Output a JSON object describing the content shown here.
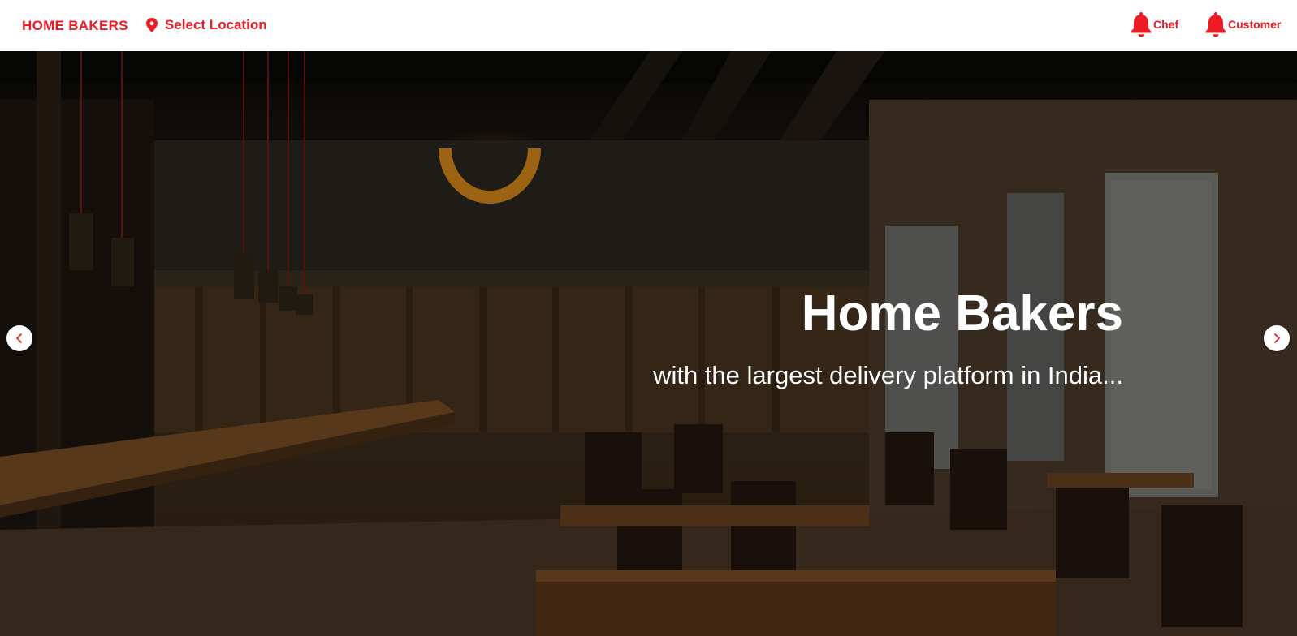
{
  "navbar": {
    "brand": "HOME BAKERS",
    "location_label": "Select Location",
    "links": [
      {
        "label": "Chef",
        "icon": "bell-icon"
      },
      {
        "label": "Customer",
        "icon": "bell-icon"
      }
    ]
  },
  "hero": {
    "title": "Home Bakers",
    "subtitle": "with the largest delivery platform in India...",
    "prev_icon": "chevron-left-icon",
    "next_icon": "chevron-right-icon"
  },
  "colors": {
    "accent": "#ed1c24",
    "hero_text": "#ffffff"
  }
}
